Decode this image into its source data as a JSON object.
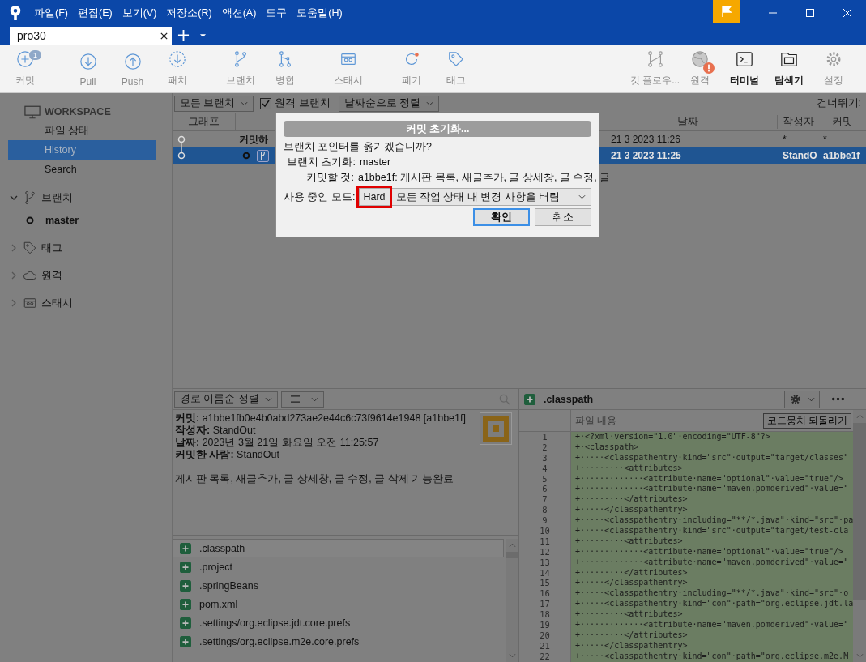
{
  "title_bar": {
    "menus": [
      "파일(F)",
      "편집(E)",
      "보기(V)",
      "저장소(R)",
      "액션(A)",
      "도구",
      "도움말(H)"
    ]
  },
  "tabs": [
    {
      "label": "pro30",
      "selected": true
    }
  ],
  "toolbar": {
    "left_groups": [
      {
        "items": [
          {
            "kind": "commit",
            "label": "커밋",
            "badge": "1",
            "disabled": true
          }
        ]
      },
      {
        "items": [
          {
            "kind": "pull",
            "label": "Pull",
            "disabled": true
          },
          {
            "kind": "push",
            "label": "Push",
            "disabled": true
          },
          {
            "kind": "patch",
            "label": "패치",
            "disabled": true
          }
        ]
      },
      {
        "items": [
          {
            "kind": "branch",
            "label": "브랜치",
            "disabled": true
          },
          {
            "kind": "merge",
            "label": "병합",
            "disabled": true
          }
        ]
      },
      {
        "items": [
          {
            "kind": "stash",
            "label": "스태시",
            "disabled": true
          }
        ]
      },
      {
        "items": [
          {
            "kind": "discard",
            "label": "폐기",
            "disabled": true
          },
          {
            "kind": "tag",
            "label": "태그",
            "disabled": true
          }
        ]
      }
    ],
    "right_items": [
      {
        "kind": "gitflow",
        "label": "깃 플로우...",
        "disabled": true
      },
      {
        "kind": "remote",
        "label": "원격",
        "disabled": true,
        "alert": true
      },
      {
        "kind": "terminal",
        "label": "터미널",
        "disabled": false
      },
      {
        "kind": "explorer",
        "label": "탐색기",
        "disabled": false
      },
      {
        "kind": "settings",
        "label": "설정",
        "disabled": true
      }
    ]
  },
  "sidebar": {
    "workspace": {
      "title": "WORKSPACE",
      "items": [
        {
          "label": "파일 상태",
          "selected": false
        },
        {
          "label": "History",
          "selected": true
        },
        {
          "label": "Search",
          "selected": false
        }
      ]
    },
    "sections": [
      {
        "kind": "branches",
        "label": "브랜치",
        "expanded": true,
        "children": [
          {
            "label": "master",
            "current": true
          }
        ]
      },
      {
        "kind": "tags",
        "label": "태그",
        "expanded": false
      },
      {
        "kind": "remotes",
        "label": "원격",
        "expanded": false
      },
      {
        "kind": "stashes",
        "label": "스태시",
        "expanded": false
      }
    ]
  },
  "filter_bar": {
    "branch_filter": "모든 브랜치",
    "remote_branches": {
      "label": "원격 브랜치",
      "checked": true
    },
    "sort": "날짜순으로 정렬",
    "jump_label": "건너뛰기:"
  },
  "history": {
    "graph_header": "그래프",
    "date_header": "날짜",
    "author_header": "작성자",
    "commit_header": "커밋",
    "rows": [
      {
        "kind": "uncommitted",
        "description": "커밋하",
        "date": "21 3 2023 11:26",
        "author": "*",
        "commit": "*",
        "selected": false
      },
      {
        "kind": "commit",
        "head": true,
        "date": "21 3 2023 11:25",
        "author": "StandO",
        "commit": "a1bbe1f",
        "selected": true
      }
    ]
  },
  "dialog": {
    "title": "커밋 초기화...",
    "question": "브랜치 포인터를 옮기겠습니까?",
    "fields": [
      {
        "label": "브랜치 초기화:",
        "value": "master"
      },
      {
        "label": "커밋할 것:",
        "value": "a1bbe1f: 게시판 목록, 새글추가, 글 상세창, 글 수정, 글"
      }
    ],
    "mode": {
      "label": "사용 중인 모드:",
      "value": "Hard",
      "description": "모든 작업 상태 내 변경 사항을 버림",
      "highlighted": true
    },
    "buttons": [
      {
        "label": "확인",
        "focused": true
      },
      {
        "label": "취소",
        "focused": false
      }
    ]
  },
  "file_panel": {
    "sort": "경로 이름순 정렬",
    "details": [
      "**커밋:** a1bbe1fb0e4b0abd273ae2e44c6c73f9614e1948 [a1bbe1f]",
      "**작성자:** StandOut",
      "**날짜:** 2023년 3월 21일 화요일 오전 11:25:57",
      "**커밋한 사람:** StandOut"
    ],
    "message": "게시판 목록, 새글추가, 글 상세창, 글 수정, 글 삭제 기능완료",
    "files": [
      {
        "name": ".classpath",
        "added": true,
        "selected": true
      },
      {
        "name": ".project",
        "added": true,
        "selected": false
      },
      {
        "name": ".springBeans",
        "added": true,
        "selected": false
      },
      {
        "name": "pom.xml",
        "added": true,
        "selected": false
      },
      {
        "name": ".settings/org.eclipse.jdt.core.prefs",
        "added": true,
        "selected": false
      },
      {
        "name": ".settings/org.eclipse.m2e.core.prefs",
        "added": true,
        "selected": false
      }
    ]
  },
  "diff": {
    "file": ".classpath",
    "added": true,
    "header": "파일 내용",
    "revert_button": "코드뭉치 되돌리기",
    "lines": [
      {
        "number": "1",
        "text": "+·<?xml·version=\"1.0\"·encoding=\"UTF-8\"?>"
      },
      {
        "number": "2",
        "text": "+·<classpath>"
      },
      {
        "number": "3",
        "text": "+·····<classpathentry·kind=\"src\"·output=\"target/classes\""
      },
      {
        "number": "4",
        "text": "+·········<attributes>"
      },
      {
        "number": "5",
        "text": "+·············<attribute·name=\"optional\"·value=\"true\"/>"
      },
      {
        "number": "6",
        "text": "+·············<attribute·name=\"maven.pomderived\"·value=\""
      },
      {
        "number": "7",
        "text": "+·········</attributes>"
      },
      {
        "number": "8",
        "text": "+·····</classpathentry>"
      },
      {
        "number": "9",
        "text": "+·····<classpathentry·including=\"**/*.java\"·kind=\"src\"·pa"
      },
      {
        "number": "10",
        "text": "+·····<classpathentry·kind=\"src\"·output=\"target/test-cla"
      },
      {
        "number": "11",
        "text": "+·········<attributes>"
      },
      {
        "number": "12",
        "text": "+·············<attribute·name=\"optional\"·value=\"true\"/>"
      },
      {
        "number": "13",
        "text": "+·············<attribute·name=\"maven.pomderived\"·value=\""
      },
      {
        "number": "14",
        "text": "+·········</attributes>"
      },
      {
        "number": "15",
        "text": "+·····</classpathentry>"
      },
      {
        "number": "16",
        "text": "+·····<classpathentry·including=\"**/*.java\"·kind=\"src\"·o"
      },
      {
        "number": "17",
        "text": "+·····<classpathentry·kind=\"con\"·path=\"org.eclipse.jdt.la"
      },
      {
        "number": "18",
        "text": "+·········<attributes>"
      },
      {
        "number": "19",
        "text": "+·············<attribute·name=\"maven.pomderived\"·value=\""
      },
      {
        "number": "20",
        "text": "+·········</attributes>"
      },
      {
        "number": "21",
        "text": "+·····</classpathentry>"
      },
      {
        "number": "22",
        "text": "+·····<classpathentry·kind=\"con\"·path=\"org.eclipse.m2e.M"
      }
    ]
  }
}
